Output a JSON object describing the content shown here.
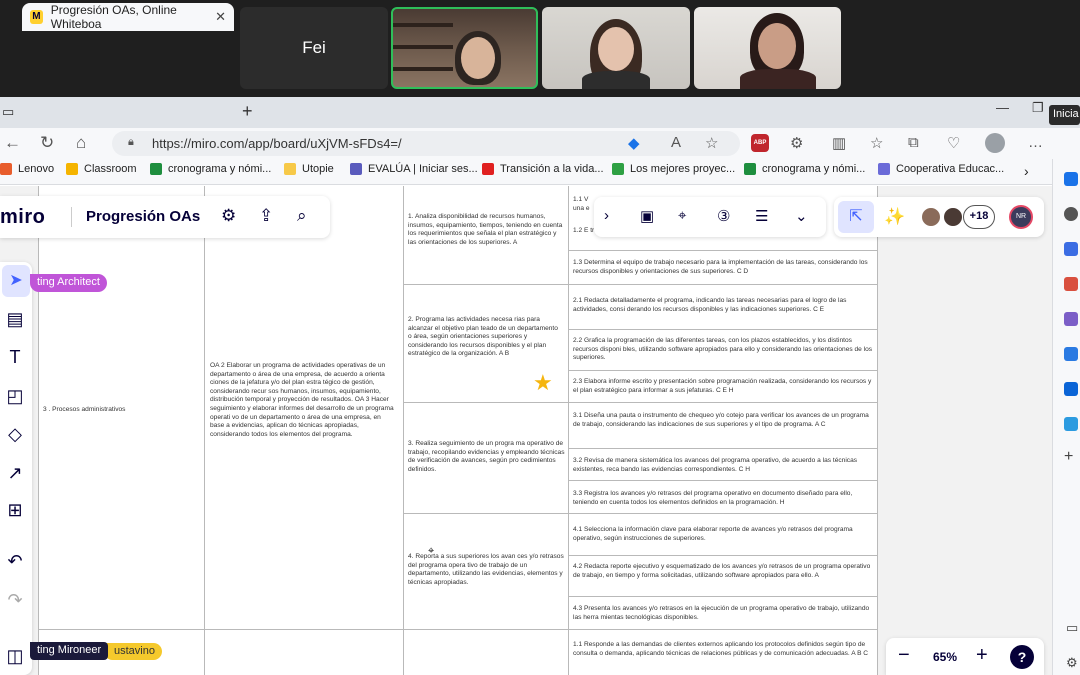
{
  "meeting": {
    "participant_name": "Fei"
  },
  "browser": {
    "tab_title": "Progresión OAs, Online Whiteboa",
    "tab_favicon": "M",
    "url": "https://miro.com/app/board/uXjVM-sFDs4=/",
    "tooltip": "Inicia",
    "bookmarks": [
      {
        "label": "Lenovo",
        "color": "#e85d2c"
      },
      {
        "label": "Classroom",
        "color": "#f5b400"
      },
      {
        "label": "cronograma y nómi...",
        "color": "#1e8e3e"
      },
      {
        "label": "Utopie",
        "color": "#f7c948"
      },
      {
        "label": "EVALÚA | Iniciar ses...",
        "color": "#5a5bbd"
      },
      {
        "label": "Transición a la vida...",
        "color": "#e02020"
      },
      {
        "label": "Los mejores proyec...",
        "color": "#2ea043"
      },
      {
        "label": "cronograma y nómi...",
        "color": "#1e8e3e"
      },
      {
        "label": "Cooperativa Educac...",
        "color": "#6b6bd8"
      }
    ]
  },
  "miro": {
    "logo": "miro",
    "board_title": "Progresión OAs",
    "collaborators_extra": "+18",
    "user_initials": "NR",
    "zoom": "65%",
    "help": "?",
    "cursor_tags": {
      "architect": "ting Architect",
      "mironeer": "ting Mironeer",
      "stavino": "ustavino"
    }
  },
  "table": {
    "module": "3 . Procesos administrativos",
    "oa_text": "OA 2 Elaborar un programa de actividades  operativas de un departamento o área  de una empresa, de acuerdo a orienta ciones de la jefatura y/o del plan estra tégico de gestión, considerando recur sos humanos, insumos, equipamiento,  distribución temporal y proyección de resultados. OA 3 Hacer seguimiento y elaborar informes del desarrollo de un programa operati vo de un departamento o área de una  empresa, en base a evidencias, aplican do técnicas apropiadas, considerando todos los elementos del programa.",
    "aprendizajes": [
      "1. Analiza disponibilidad de recursos  humanos, insumos, equipamiento,  tiempos, teniendo en cuenta los  requerimientos que señala el plan estratégico y las orientaciones de los superiores. A",
      "2. Programa las actividades necesa rias para alcanzar el objetivo plan teado de un departamento o área,  según orientaciones superiores y  considerando los recursos disponibles y el plan  estratégico de la organización. A B",
      "3. Realiza seguimiento de un progra ma operativo de trabajo, recopilando  evidencias y empleando técnicas de  verificación de avances, según pro cedimientos definidos.",
      "4. Reporta a sus superiores los avan ces y/o retrasos del programa opera tivo de trabajo de un departamento,  utilizando las evidencias, elementos  y técnicas apropiadas."
    ],
    "criterios": [
      "1.1 V una e",
      "1.2 E trabajo, considerando los  recursos disponibles y las instrucciones entregadas. H",
      "1.3 Determina el equipo de trabajo necesario para la implementación de las tareas, considerando los recursos  disponibles y orientaciones de sus superiores. C D",
      "2.1 Redacta detalladamente el programa, indicando las tareas necesarias para el logro de las actividades, consi derando los recursos disponibles y las indicaciones superiores. C E",
      "2.2 Grafica la programación de las diferentes tareas, con los plazos establecidos, y los distintos recursos disponi bles, utilizando software apropiados para ello y considerando las orientaciones de los superiores.",
      "2.3 Elabora informe escrito y presentación sobre programación realizada, considerando los recursos y el plan  estratégico para informar a sus jefaturas. C E H",
      "3.1 Diseña una pauta o instrumento de chequeo y/o cotejo para verificar los avances de un programa de trabajo,  considerando las indicaciones de sus superiores y el tipo de programa. A C",
      "3.2 Revisa de manera sistemática los avances del programa operativo, de acuerdo a las técnicas existentes, reca bando las evidencias correspondientes. C H",
      "3.3 Registra los avances y/o retrasos del programa operativo en documento diseñado para ello, teniendo en  cuenta todos los elementos definidos en la programación. H",
      "4.1 Selecciona la información clave para elaborar reporte de avances y/o retrasos del programa operativo, según  instrucciones de superiores.",
      "4.2 Redacta reporte ejecutivo y esquematizado de los avances y/o retrasos de un programa operativo de trabajo,  en tiempo y forma solicitadas, utilizando software apropiados para ello. A",
      "4.3 Presenta los avances y/o retrasos en la ejecución de un programa operativo de trabajo, utilizando las herra mientas tecnológicas disponibles.",
      "1.1 Responde a las demandas de clientes externos aplicando los protocolos definidos según tipo de consulta o  demanda, aplicando técnicas de relaciones públicas y de comunicación adecuadas. A B C"
    ]
  }
}
